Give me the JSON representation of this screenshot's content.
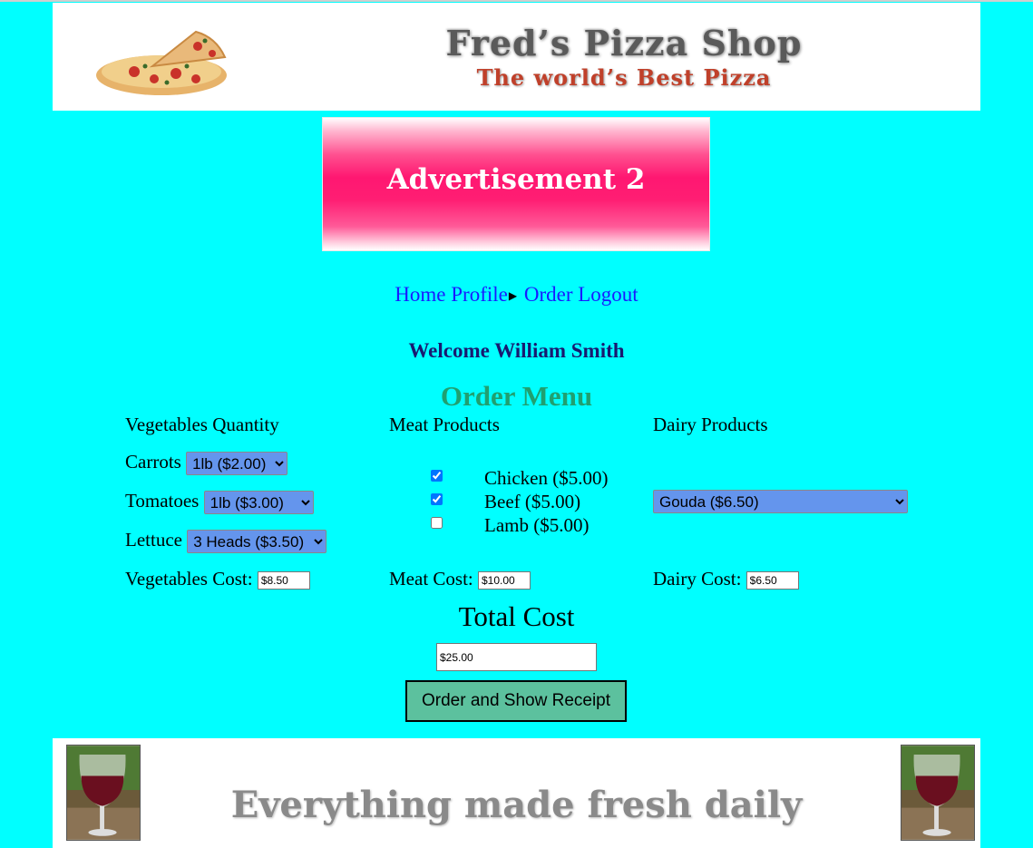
{
  "header": {
    "title": "Fred’s Pizza Shop",
    "subtitle": "The world’s Best Pizza",
    "logo_icon": "pizza-icon"
  },
  "advertisement": {
    "text": "Advertisement 2"
  },
  "nav": {
    "items": [
      "Home",
      "Profile",
      "Order",
      "Logout"
    ],
    "separator_icon": "caret-right-icon"
  },
  "welcome": "Welcome William Smith",
  "order_menu": {
    "title": "Order Menu",
    "vegetables": {
      "heading": "Vegetables Quantity",
      "items": [
        {
          "label": "Carrots",
          "selected": "1lb ($2.00)"
        },
        {
          "label": "Tomatoes",
          "selected": "1lb ($3.00)"
        },
        {
          "label": "Lettuce",
          "selected": "3 Heads ($3.50)"
        }
      ],
      "cost_label": "Vegetables Cost:",
      "cost_value": "$8.50"
    },
    "meat": {
      "heading": "Meat Products",
      "items": [
        {
          "label": "Chicken ($5.00)",
          "checked": true
        },
        {
          "label": "Beef ($5.00)",
          "checked": true
        },
        {
          "label": "Lamb ($5.00)",
          "checked": false
        }
      ],
      "cost_label": "Meat Cost:",
      "cost_value": "$10.00"
    },
    "dairy": {
      "heading": "Dairy Products",
      "selected": "Gouda ($6.50)",
      "cost_label": "Dairy Cost:",
      "cost_value": "$6.50"
    },
    "total": {
      "title": "Total Cost",
      "value": "$25.00"
    },
    "submit_label": "Order and Show Receipt"
  },
  "footer": {
    "text": "Everything made fresh daily",
    "image_icon": "wine-glass-icon"
  },
  "colors": {
    "background": "#00ffff",
    "link": "#1a1aff",
    "welcome": "#191970",
    "menu_title": "#20a070",
    "select_bg": "#6495ed",
    "button_bg": "#5cc19e",
    "ad_pink": "#ff1771"
  }
}
